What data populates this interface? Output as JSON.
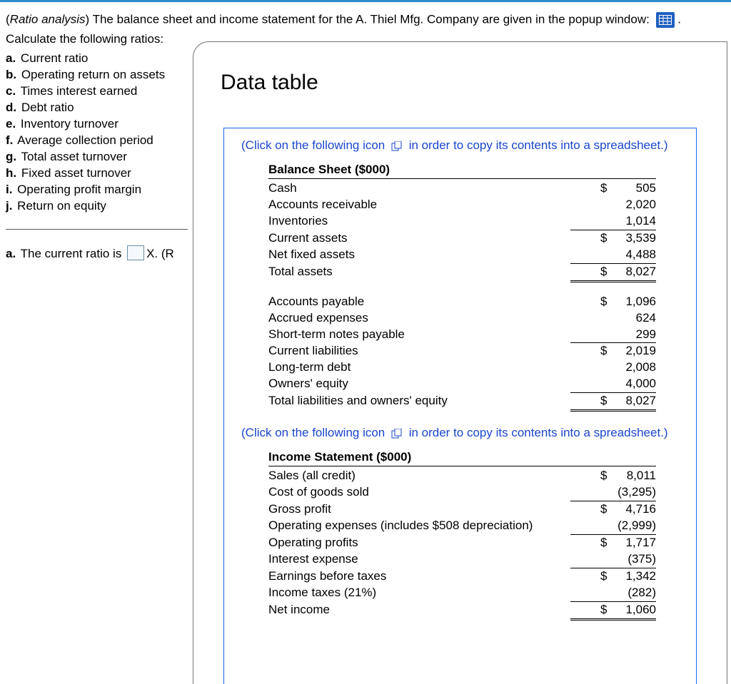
{
  "intro": {
    "prefix": "(",
    "title_italic": "Ratio analysis",
    "body": ") The balance sheet and income statement for the A. Thiel Mfg. Company are given in the popup window: ",
    "trailing_period": " .",
    "calc_line": "Calculate the following ratios:"
  },
  "ratios": [
    {
      "k": "a.",
      "t": "Current ratio"
    },
    {
      "k": "b.",
      "t": "Operating return on assets"
    },
    {
      "k": "c.",
      "t": "Times interest earned"
    },
    {
      "k": "d.",
      "t": "Debt ratio"
    },
    {
      "k": "e.",
      "t": "Inventory turnover"
    },
    {
      "k": "f.",
      "t": "Average collection period"
    },
    {
      "k": "g.",
      "t": "Total asset turnover"
    },
    {
      "k": "h.",
      "t": "Fixed asset turnover"
    },
    {
      "k": "i.",
      "t": "Operating profit margin"
    },
    {
      "k": "j.",
      "t": "Return on equity"
    }
  ],
  "answer_row": {
    "k": "a.",
    "before": "The current ratio is",
    "after": "X. (R"
  },
  "panel": {
    "title": "Data table"
  },
  "click_hint": {
    "pre": "(Click on the following icon ",
    "post": " in order to copy its contents into a spreadsheet.)"
  },
  "balance_sheet": {
    "header": "Balance Sheet ($000)",
    "rows": [
      {
        "lab": "Cash",
        "doll": "$",
        "val": "505",
        "rule": ""
      },
      {
        "lab": "Accounts receivable",
        "doll": "",
        "val": "2,020",
        "rule": ""
      },
      {
        "lab": "Inventories",
        "doll": "",
        "val": "1,014",
        "rule": "rb"
      },
      {
        "lab": "Current assets",
        "doll": "$",
        "val": "3,539",
        "rule": ""
      },
      {
        "lab": "Net fixed assets",
        "doll": "",
        "val": "4,488",
        "rule": "rb"
      },
      {
        "lab": "Total assets",
        "doll": "$",
        "val": "8,027",
        "rule": "db"
      }
    ],
    "rows2": [
      {
        "lab": "Accounts payable",
        "doll": "$",
        "val": "1,096",
        "rule": ""
      },
      {
        "lab": "Accrued expenses",
        "doll": "",
        "val": "624",
        "rule": ""
      },
      {
        "lab": "Short-term notes payable",
        "doll": "",
        "val": "299",
        "rule": "rb"
      },
      {
        "lab": "Current liabilities",
        "doll": "$",
        "val": "2,019",
        "rule": ""
      },
      {
        "lab": "Long-term debt",
        "doll": "",
        "val": "2,008",
        "rule": ""
      },
      {
        "lab": "Owners' equity",
        "doll": "",
        "val": "4,000",
        "rule": "rb"
      },
      {
        "lab": "Total liabilities and owners' equity",
        "doll": "$",
        "val": "8,027",
        "rule": "db"
      }
    ]
  },
  "income_statement": {
    "header": "Income Statement ($000)",
    "rows": [
      {
        "lab": "Sales (all credit)",
        "doll": "$",
        "val": "8,011",
        "rule": ""
      },
      {
        "lab": "Cost of goods sold",
        "doll": "",
        "val": "(3,295)",
        "rule": "rb"
      },
      {
        "lab": "Gross profit",
        "doll": "$",
        "val": "4,716",
        "rule": ""
      },
      {
        "lab": "Operating expenses (includes $508 depreciation)",
        "doll": "",
        "val": "(2,999)",
        "rule": "rb"
      },
      {
        "lab": "Operating profits",
        "doll": "$",
        "val": "1,717",
        "rule": ""
      },
      {
        "lab": "Interest expense",
        "doll": "",
        "val": "(375)",
        "rule": "rb"
      },
      {
        "lab": "Earnings before taxes",
        "doll": "$",
        "val": "1,342",
        "rule": ""
      },
      {
        "lab": "Income taxes (21%)",
        "doll": "",
        "val": "(282)",
        "rule": "rb"
      },
      {
        "lab": "Net income",
        "doll": "$",
        "val": "1,060",
        "rule": "db"
      }
    ]
  },
  "chart_data": {
    "type": "table",
    "tables": [
      {
        "name": "Balance Sheet ($000)",
        "rows": [
          [
            "Cash",
            505
          ],
          [
            "Accounts receivable",
            2020
          ],
          [
            "Inventories",
            1014
          ],
          [
            "Current assets",
            3539
          ],
          [
            "Net fixed assets",
            4488
          ],
          [
            "Total assets",
            8027
          ],
          [
            "Accounts payable",
            1096
          ],
          [
            "Accrued expenses",
            624
          ],
          [
            "Short-term notes payable",
            299
          ],
          [
            "Current liabilities",
            2019
          ],
          [
            "Long-term debt",
            2008
          ],
          [
            "Owners' equity",
            4000
          ],
          [
            "Total liabilities and owners' equity",
            8027
          ]
        ]
      },
      {
        "name": "Income Statement ($000)",
        "rows": [
          [
            "Sales (all credit)",
            8011
          ],
          [
            "Cost of goods sold",
            -3295
          ],
          [
            "Gross profit",
            4716
          ],
          [
            "Operating expenses (includes $508 depreciation)",
            -2999
          ],
          [
            "Operating profits",
            1717
          ],
          [
            "Interest expense",
            -375
          ],
          [
            "Earnings before taxes",
            1342
          ],
          [
            "Income taxes (21%)",
            -282
          ],
          [
            "Net income",
            1060
          ]
        ]
      }
    ]
  }
}
